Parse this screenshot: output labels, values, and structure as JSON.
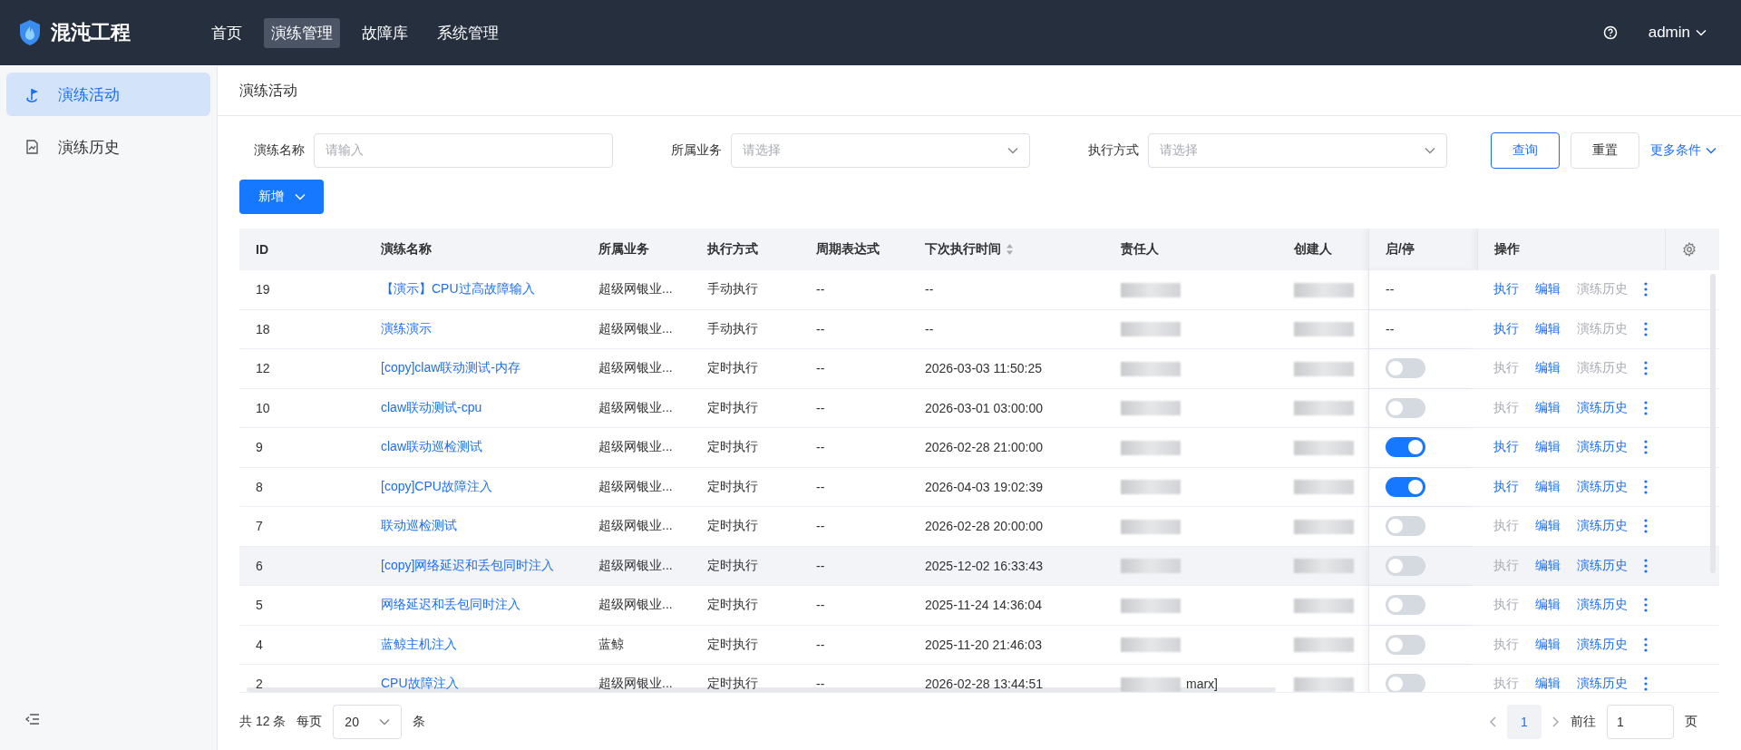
{
  "app": {
    "title": "混沌工程"
  },
  "nav": [
    {
      "label": "首页",
      "selected": false
    },
    {
      "label": "演练管理",
      "selected": true
    },
    {
      "label": "故障库",
      "selected": false
    },
    {
      "label": "系统管理",
      "selected": false
    }
  ],
  "user": {
    "name": "admin"
  },
  "sidebar": {
    "items": [
      {
        "label": "演练活动",
        "selected": true,
        "kind": "flag"
      },
      {
        "label": "演练历史",
        "selected": false,
        "kind": "chart"
      }
    ]
  },
  "page": {
    "title": "演练活动"
  },
  "filters": [
    {
      "label": "演练名称",
      "kind": "input",
      "placeholder": "请输入"
    },
    {
      "label": "所属业务",
      "kind": "select",
      "placeholder": "请选择"
    },
    {
      "label": "执行方式",
      "kind": "select",
      "placeholder": "请选择"
    }
  ],
  "filter_buttons": [
    {
      "label": "查询",
      "kind": "outline"
    },
    {
      "label": "重置",
      "kind": "plain"
    }
  ],
  "more_filters": "更多条件",
  "add_button": "新增",
  "table": {
    "columns": [
      {
        "label": "ID",
        "kind": "plain"
      },
      {
        "label": "演练名称",
        "kind": "plain"
      },
      {
        "label": "所属业务",
        "kind": "plain"
      },
      {
        "label": "执行方式",
        "kind": "plain"
      },
      {
        "label": "周期表达式",
        "kind": "plain"
      },
      {
        "label": "下次执行时间",
        "kind": "sortable"
      },
      {
        "label": "责任人",
        "kind": "plain"
      },
      {
        "label": "创建人",
        "kind": "plain"
      },
      {
        "label": "启/停",
        "kind": "plain"
      },
      {
        "label": "操作",
        "kind": "plain"
      }
    ],
    "rows": [
      {
        "id": "19",
        "name": "【演示】CPU过高故障输入",
        "business": "超级网银业...",
        "mode": "手动执行",
        "cycle": "--",
        "next_time": "--",
        "hovered": false,
        "toggle": {
          "kind": "text",
          "text": "--"
        },
        "actions": [
          {
            "label": "执行",
            "disabled": false
          },
          {
            "label": "编辑",
            "disabled": false
          },
          {
            "label": "演练历史",
            "disabled": true
          }
        ]
      },
      {
        "id": "18",
        "name": "演练演示",
        "business": "超级网银业...",
        "mode": "手动执行",
        "cycle": "--",
        "next_time": "--",
        "hovered": false,
        "toggle": {
          "kind": "text",
          "text": "--"
        },
        "actions": [
          {
            "label": "执行",
            "disabled": false
          },
          {
            "label": "编辑",
            "disabled": false
          },
          {
            "label": "演练历史",
            "disabled": true
          }
        ]
      },
      {
        "id": "12",
        "name": "[copy]claw联动测试-内存",
        "business": "超级网银业...",
        "mode": "定时执行",
        "cycle": "--",
        "next_time": "2026-03-03 11:50:25",
        "hovered": false,
        "toggle": {
          "kind": "switch",
          "on": false
        },
        "actions": [
          {
            "label": "执行",
            "disabled": true
          },
          {
            "label": "编辑",
            "disabled": false
          },
          {
            "label": "演练历史",
            "disabled": true
          }
        ]
      },
      {
        "id": "10",
        "name": "claw联动测试-cpu",
        "business": "超级网银业...",
        "mode": "定时执行",
        "cycle": "--",
        "next_time": "2026-03-01 03:00:00",
        "hovered": false,
        "toggle": {
          "kind": "switch",
          "on": false
        },
        "actions": [
          {
            "label": "执行",
            "disabled": true
          },
          {
            "label": "编辑",
            "disabled": false
          },
          {
            "label": "演练历史",
            "disabled": false
          }
        ]
      },
      {
        "id": "9",
        "name": "claw联动巡检测试",
        "business": "超级网银业...",
        "mode": "定时执行",
        "cycle": "--",
        "next_time": "2026-02-28 21:00:00",
        "hovered": false,
        "toggle": {
          "kind": "switch",
          "on": true
        },
        "actions": [
          {
            "label": "执行",
            "disabled": false
          },
          {
            "label": "编辑",
            "disabled": false
          },
          {
            "label": "演练历史",
            "disabled": false
          }
        ]
      },
      {
        "id": "8",
        "name": "[copy]CPU故障注入",
        "business": "超级网银业...",
        "mode": "定时执行",
        "cycle": "--",
        "next_time": "2026-04-03 19:02:39",
        "hovered": false,
        "toggle": {
          "kind": "switch",
          "on": true
        },
        "actions": [
          {
            "label": "执行",
            "disabled": false
          },
          {
            "label": "编辑",
            "disabled": false
          },
          {
            "label": "演练历史",
            "disabled": false
          }
        ]
      },
      {
        "id": "7",
        "name": "联动巡检测试",
        "business": "超级网银业...",
        "mode": "定时执行",
        "cycle": "--",
        "next_time": "2026-02-28 20:00:00",
        "hovered": false,
        "toggle": {
          "kind": "switch",
          "on": false
        },
        "actions": [
          {
            "label": "执行",
            "disabled": true
          },
          {
            "label": "编辑",
            "disabled": false
          },
          {
            "label": "演练历史",
            "disabled": false
          }
        ]
      },
      {
        "id": "6",
        "name": "[copy]网络延迟和丢包同时注入",
        "business": "超级网银业...",
        "mode": "定时执行",
        "cycle": "--",
        "next_time": "2025-12-02 16:33:43",
        "hovered": true,
        "toggle": {
          "kind": "switch",
          "on": false
        },
        "actions": [
          {
            "label": "执行",
            "disabled": true
          },
          {
            "label": "编辑",
            "disabled": false
          },
          {
            "label": "演练历史",
            "disabled": false
          }
        ]
      },
      {
        "id": "5",
        "name": "网络延迟和丢包同时注入",
        "business": "超级网银业...",
        "mode": "定时执行",
        "cycle": "--",
        "next_time": "2025-11-24 14:36:04",
        "hovered": false,
        "toggle": {
          "kind": "switch",
          "on": false
        },
        "actions": [
          {
            "label": "执行",
            "disabled": true
          },
          {
            "label": "编辑",
            "disabled": false
          },
          {
            "label": "演练历史",
            "disabled": false
          }
        ]
      },
      {
        "id": "4",
        "name": "蓝鲸主机注入",
        "business": "蓝鲸",
        "mode": "定时执行",
        "cycle": "--",
        "next_time": "2025-11-20 21:46:03",
        "hovered": false,
        "toggle": {
          "kind": "switch",
          "on": false
        },
        "actions": [
          {
            "label": "执行",
            "disabled": true
          },
          {
            "label": "编辑",
            "disabled": false
          },
          {
            "label": "演练历史",
            "disabled": false
          }
        ]
      },
      {
        "id": "2",
        "name": "CPU故障注入",
        "business": "超级网银业...",
        "mode": "定时执行",
        "cycle": "--",
        "next_time": "2026-02-28 13:44:51",
        "owner": "marx]",
        "hovered": false,
        "toggle": {
          "kind": "switch",
          "on": false
        },
        "actions": [
          {
            "label": "执行",
            "disabled": true
          },
          {
            "label": "编辑",
            "disabled": false
          },
          {
            "label": "演练历史",
            "disabled": false
          }
        ]
      }
    ]
  },
  "pagination": {
    "total": "共 12 条",
    "per_page_label": "每页",
    "page_size": "20",
    "unit": "条",
    "current_page": "1",
    "goto_label": "前往",
    "goto_value": "1",
    "page_label": "页"
  }
}
